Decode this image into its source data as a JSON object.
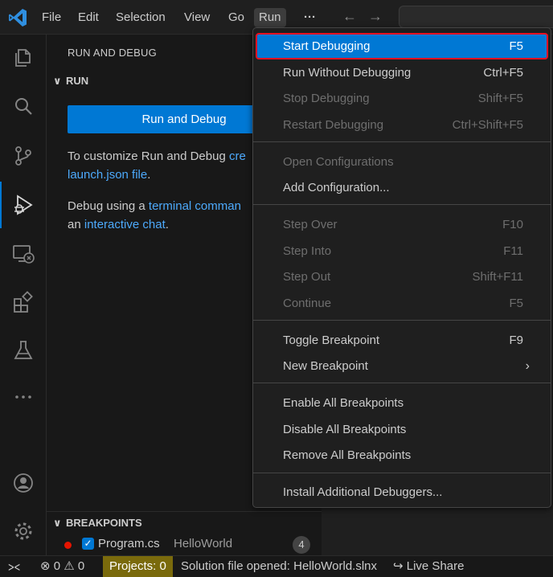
{
  "menubar": {
    "items": [
      "File",
      "Edit",
      "Selection",
      "View",
      "Go",
      "Run"
    ],
    "more": "···",
    "back": "←",
    "forward": "→"
  },
  "sidebar": {
    "title": "RUN AND DEBUG",
    "run_section": "RUN",
    "run_button": "Run and Debug",
    "para1": {
      "text1": "To customize Run and Debug ",
      "link1": "cre",
      "link2": "launch.json file",
      "text2": "."
    },
    "para2": {
      "text1": "Debug using a ",
      "link1": "terminal comman",
      "text2": "an ",
      "link2": "interactive chat",
      "text3": "."
    },
    "breakpoints": {
      "header": "BREAKPOINTS",
      "file": "Program.cs",
      "project": "HelloWorld",
      "count": "4"
    }
  },
  "run_menu": {
    "items": [
      {
        "label": "Start Debugging",
        "key": "F5",
        "enabled": true,
        "highlighted": true
      },
      {
        "label": "Run Without Debugging",
        "key": "Ctrl+F5",
        "enabled": true
      },
      {
        "label": "Stop Debugging",
        "key": "Shift+F5",
        "enabled": false
      },
      {
        "label": "Restart Debugging",
        "key": "Ctrl+Shift+F5",
        "enabled": false
      },
      {
        "label": "Open Configurations",
        "key": "",
        "enabled": false
      },
      {
        "label": "Add Configuration...",
        "key": "",
        "enabled": true
      },
      {
        "label": "Step Over",
        "key": "F10",
        "enabled": false
      },
      {
        "label": "Step Into",
        "key": "F11",
        "enabled": false
      },
      {
        "label": "Step Out",
        "key": "Shift+F11",
        "enabled": false
      },
      {
        "label": "Continue",
        "key": "F5",
        "enabled": false
      },
      {
        "label": "Toggle Breakpoint",
        "key": "F9",
        "enabled": true
      },
      {
        "label": "New Breakpoint",
        "key": "",
        "enabled": true,
        "submenu": true
      },
      {
        "label": "Enable All Breakpoints",
        "key": "",
        "enabled": true
      },
      {
        "label": "Disable All Breakpoints",
        "key": "",
        "enabled": true
      },
      {
        "label": "Remove All Breakpoints",
        "key": "",
        "enabled": true
      },
      {
        "label": "Install Additional Debuggers...",
        "key": "",
        "enabled": true
      }
    ]
  },
  "statusbar": {
    "errors": "0",
    "warnings": "0",
    "projects": "Projects: 0",
    "solution": "Solution file opened: HelloWorld.slnx",
    "live_share": "Live Share"
  },
  "colors": {
    "accent": "#0078d4",
    "highlight_border": "#e81123",
    "breakpoint": "#e51400",
    "projects_badge": "#7a6a0c"
  }
}
